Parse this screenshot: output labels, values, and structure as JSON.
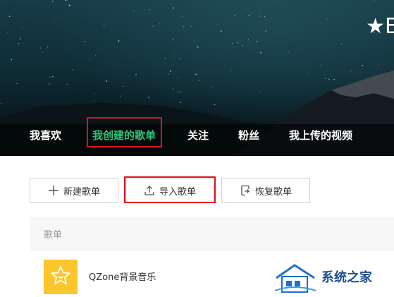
{
  "header": {
    "title": "★E",
    "tabs": [
      {
        "label": "我喜欢",
        "active": false
      },
      {
        "label": "我创建的歌单",
        "active": true
      },
      {
        "label": "关注",
        "active": false
      },
      {
        "label": "粉丝",
        "active": false
      },
      {
        "label": "我上传的视频",
        "active": false
      }
    ]
  },
  "toolbar": {
    "new_playlist_label": "新建歌单",
    "import_playlist_label": "导入歌单",
    "restore_playlist_label": "恢复歌单"
  },
  "list": {
    "header_label": "歌单",
    "rows": [
      {
        "title": "QZone背景音乐",
        "icon": "star-face-icon"
      }
    ]
  },
  "watermark": {
    "text": "系统之家"
  },
  "colors": {
    "active_tab": "#31c27c",
    "highlight_box": "#e0141b",
    "cover_bg": "#fbc52c"
  }
}
